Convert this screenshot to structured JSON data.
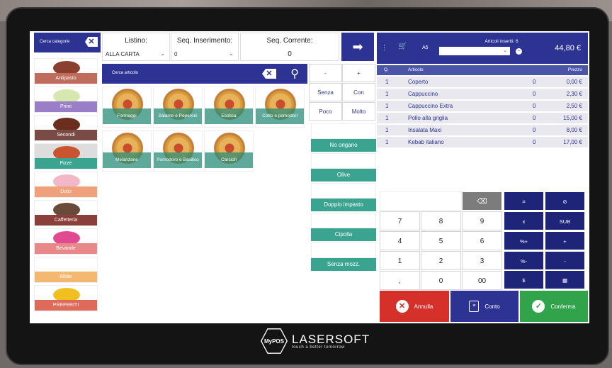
{
  "categories": {
    "search_placeholder": "Cerca categorie",
    "items": [
      {
        "label": "Antipasto",
        "color": "#c06c5c",
        "pic": "#8a3f2f"
      },
      {
        "label": "Primi",
        "color": "#9a7fc8",
        "pic": "#d8e6b0"
      },
      {
        "label": "Secondi",
        "color": "#7a4a44",
        "pic": "#6b2e1e"
      },
      {
        "label": "Pizze",
        "color": "#3aa490",
        "pic": "#c9542f"
      },
      {
        "label": "Dolci",
        "color": "#f0a07a",
        "pic": "#f2b8c8"
      },
      {
        "label": "Caffetteria",
        "color": "#8a3f3a",
        "pic": "#6a4a3a"
      },
      {
        "label": "Bevande",
        "color": "#e98888",
        "pic": "#e04a90"
      },
      {
        "label": "Bibite",
        "color": "#f4b870",
        "pic": "#ffffff"
      },
      {
        "label": "PREFERITI",
        "color": "#e06a5a",
        "pic": "#f0c020"
      }
    ]
  },
  "header": {
    "listino_title": "Listino:",
    "listino_value": "ALLA CARTA",
    "seq_ins_title": "Seq. Inserimento:",
    "seq_ins_value": "0",
    "seq_cur_title": "Seq. Corrente:",
    "seq_cur_value": "0"
  },
  "articles": {
    "search_placeholder": "Cerca articolo",
    "items": [
      "Formaggi",
      "Salame e Peperoni",
      "Esotica",
      "Cotto e pomodori",
      "Melanzane",
      "Pomodoro e Basilico",
      "Carciofi"
    ]
  },
  "modifiers": {
    "minus": "-",
    "plus": "+",
    "senza": "Senza",
    "con": "Con",
    "poco": "Poco",
    "molto": "Molto"
  },
  "variants": [
    "No origano",
    "Olive",
    "Doppio impasto",
    "Cipolla",
    "Senza mozz."
  ],
  "order": {
    "table": "A5",
    "inserted_label": "Articoli inseriti: 6",
    "total": "44,80 €",
    "col_qty": "Q.",
    "col_article": "Articolo",
    "col_price": "Prezzo",
    "rows": [
      {
        "q": "1",
        "name": "Coperto",
        "mod": "0",
        "price": "0,00 €"
      },
      {
        "q": "1",
        "name": "Cappuccino",
        "mod": "0",
        "price": "2,30 €"
      },
      {
        "q": "1",
        "name": "Cappuccino Extra",
        "mod": "0",
        "price": "2,50 €"
      },
      {
        "q": "1",
        "name": "Pollo alla griglia",
        "mod": "0",
        "price": "15,00 €"
      },
      {
        "q": "1",
        "name": "Insalata Maxi",
        "mod": "0",
        "price": "8,00 €"
      },
      {
        "q": "1",
        "name": "Kebab italiano",
        "mod": "0",
        "price": "17,00 €"
      }
    ]
  },
  "keypad": {
    "keys": [
      "7",
      "8",
      "9",
      "4",
      "5",
      "6",
      "1",
      "2",
      "3",
      ",",
      "0",
      "00"
    ],
    "ops": [
      "x",
      "SUB",
      "%+",
      "+",
      "%-",
      "-"
    ]
  },
  "actions": {
    "annulla": "Annulla",
    "conto": "Conto",
    "conferma": "Conferma"
  },
  "brand": {
    "badge": "MyPOS",
    "name": "LASERSOFT",
    "tagline": "touch a better tomorrow"
  }
}
